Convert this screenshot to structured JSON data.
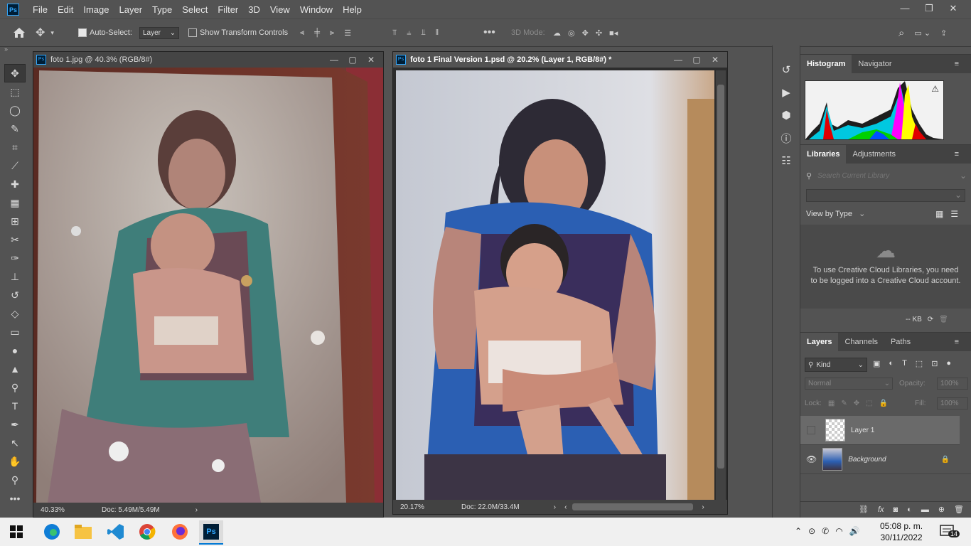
{
  "menubar": {
    "logo": "Ps",
    "items": [
      "File",
      "Edit",
      "Image",
      "Layer",
      "Type",
      "Select",
      "Filter",
      "3D",
      "View",
      "Window",
      "Help"
    ],
    "min": "—",
    "restore": "❐",
    "close": "✕"
  },
  "options": {
    "auto_select_label": "Auto-Select:",
    "auto_select_value": "Layer",
    "show_transform_label": "Show Transform Controls",
    "mode_3d_label": "3D Mode:"
  },
  "doc1": {
    "title": "foto 1.jpg @ 40.3% (RGB/8#)",
    "zoom": "40.33%",
    "doc_size": "Doc: 5.49M/5.49M"
  },
  "doc2": {
    "title": "foto 1 Final Version 1.psd @ 20.2% (Layer 1, RGB/8#) *",
    "zoom": "20.17%",
    "doc_size": "Doc: 22.0M/33.4M"
  },
  "histogram_panel": {
    "tabs": [
      "Histogram",
      "Navigator"
    ]
  },
  "libraries_panel": {
    "tabs": [
      "Libraries",
      "Adjustments"
    ],
    "search_placeholder": "Search Current Library",
    "view_by": "View by Type",
    "message": "To use Creative Cloud Libraries, you need to be logged into a Creative Cloud account.",
    "kb": "-- KB"
  },
  "layers_panel": {
    "tabs": [
      "Layers",
      "Channels",
      "Paths"
    ],
    "kind": "Kind",
    "blend_mode": "Normal",
    "opacity_label": "Opacity:",
    "opacity_value": "100%",
    "lock_label": "Lock:",
    "fill_label": "Fill:",
    "fill_value": "100%",
    "layers": [
      {
        "name": "Layer 1",
        "visible": false,
        "selected": true
      },
      {
        "name": "Background",
        "visible": true,
        "selected": false,
        "locked": true
      }
    ]
  },
  "taskbar": {
    "time": "05:08 p. m.",
    "date": "30/11/2022",
    "notifications": "14"
  },
  "colors": {
    "ps_blue": "#31a8ff",
    "panel_bg": "#535353",
    "dark_bg": "#2d2d2d"
  }
}
